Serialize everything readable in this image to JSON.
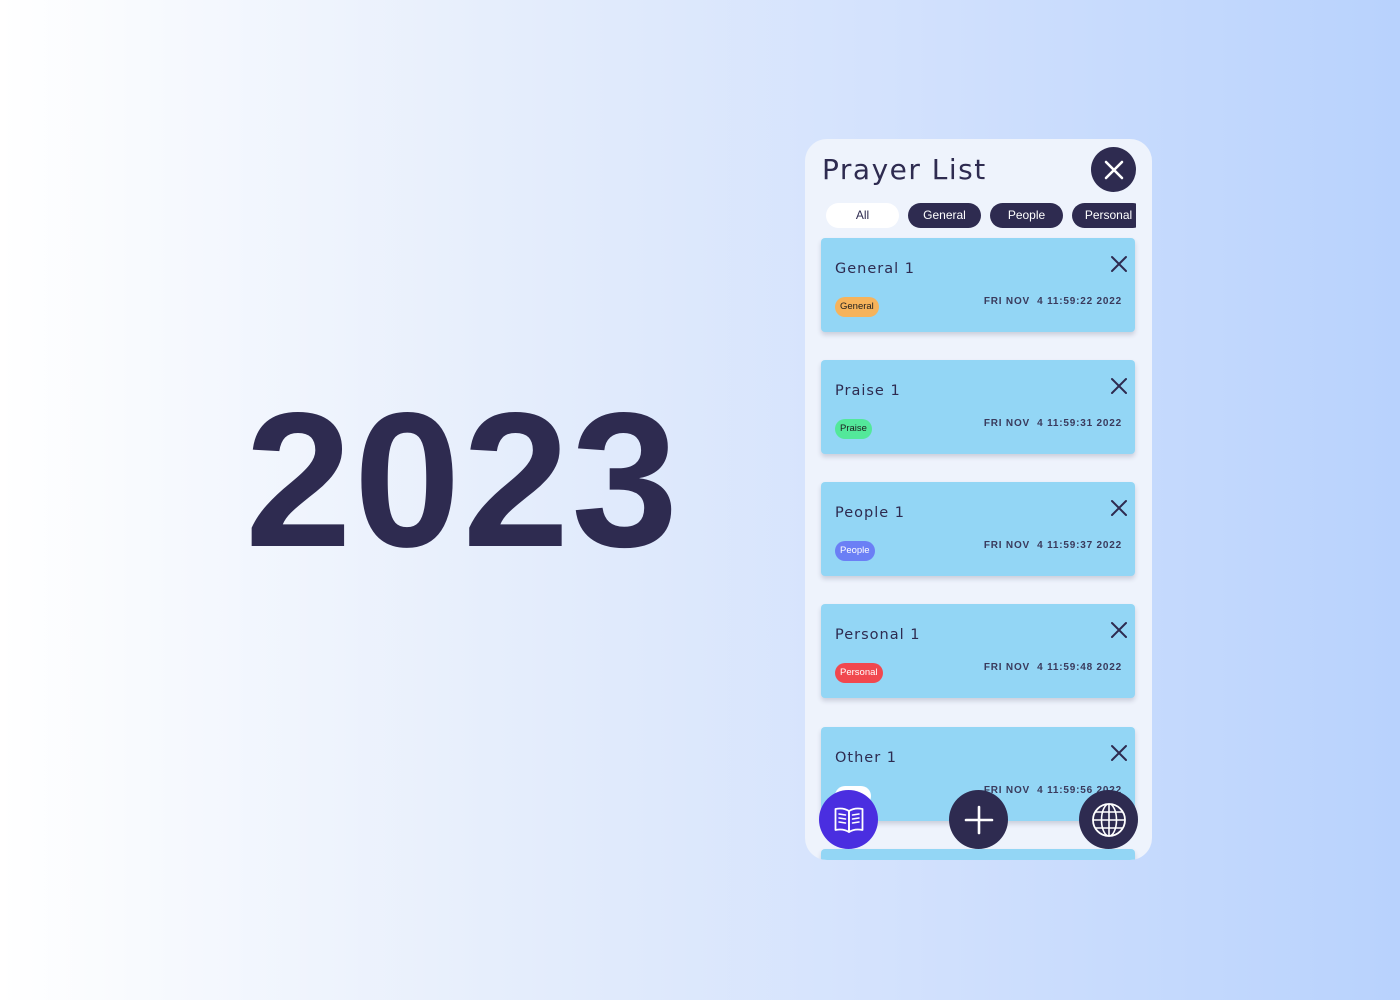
{
  "hero": {
    "year": "2023"
  },
  "app": {
    "title": "Prayer List",
    "close_icon": "close-icon"
  },
  "filters": [
    {
      "label": "All",
      "selected": true
    },
    {
      "label": "General",
      "selected": false
    },
    {
      "label": "People",
      "selected": false
    },
    {
      "label": "Personal",
      "selected": false
    }
  ],
  "prayers": [
    {
      "title": "General 1",
      "tag": "General",
      "tag_color": "#f6b35b",
      "date": "FRI NOV  4 11:59:22 2022"
    },
    {
      "title": "Praise 1",
      "tag": "Praise",
      "tag_color": "#53e89a",
      "date": "FRI NOV  4 11:59:31 2022"
    },
    {
      "title": "People 1",
      "tag": "People",
      "tag_color": "#6b7ff5",
      "date": "FRI NOV  4 11:59:37 2022"
    },
    {
      "title": "Personal 1",
      "tag": "Personal",
      "tag_color": "#f1484f",
      "date": "FRI NOV  4 11:59:48 2022"
    },
    {
      "title": "Other 1",
      "tag": "",
      "tag_color": "#ffffff",
      "date": "FRI NOV  4 11:59:56 2022"
    }
  ],
  "actions": {
    "book": "book-icon",
    "add": "plus-icon",
    "globe": "globe-icon"
  },
  "colors": {
    "primary_dark": "#2e2b50",
    "accent_purple": "#4a2ee0",
    "card_blue": "#93d6f5",
    "panel_bg": "#eef3fc"
  }
}
